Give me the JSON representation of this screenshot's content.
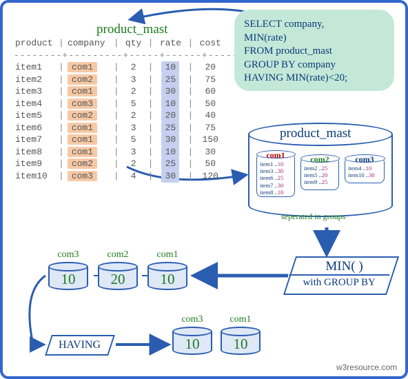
{
  "table_title": "product_mast",
  "headers": {
    "product": "product",
    "company": "company",
    "qty": "qty",
    "rate": "rate",
    "cost": "cost"
  },
  "rows": [
    {
      "product": "item1",
      "company": "com1",
      "qty": "2",
      "rate": "10",
      "cost": "20"
    },
    {
      "product": "item2",
      "company": "com2",
      "qty": "3",
      "rate": "25",
      "cost": "75"
    },
    {
      "product": "item3",
      "company": "com1",
      "qty": "2",
      "rate": "30",
      "cost": "60"
    },
    {
      "product": "item4",
      "company": "com3",
      "qty": "5",
      "rate": "10",
      "cost": "50"
    },
    {
      "product": "item5",
      "company": "com2",
      "qty": "2",
      "rate": "20",
      "cost": "40"
    },
    {
      "product": "item6",
      "company": "com1",
      "qty": "3",
      "rate": "25",
      "cost": "75"
    },
    {
      "product": "item7",
      "company": "com1",
      "qty": "5",
      "rate": "30",
      "cost": "150"
    },
    {
      "product": "item8",
      "company": "com1",
      "qty": "3",
      "rate": "10",
      "cost": "30"
    },
    {
      "product": "item9",
      "company": "com2",
      "qty": "2",
      "rate": "25",
      "cost": "50"
    },
    {
      "product": "item10",
      "company": "com3",
      "qty": "4",
      "rate": "30",
      "cost": "120"
    }
  ],
  "sql": {
    "l1": "SELECT company,",
    "l2": "MIN(rate)",
    "l3": "FROM product_mast",
    "l4": "GROUP BY company",
    "l5": "HAVING MIN(rate)<20;"
  },
  "groups_cyl_title": "product_mast",
  "groups_caption": "seperated in groups",
  "groups": {
    "com1": {
      "name": "com1",
      "items": [
        {
          "i": "item1",
          "r": "10"
        },
        {
          "i": "item3",
          "r": "30"
        },
        {
          "i": "item6",
          "r": "25"
        },
        {
          "i": "item7",
          "r": "30"
        },
        {
          "i": "item8",
          "r": "10"
        }
      ]
    },
    "com2": {
      "name": "com2",
      "items": [
        {
          "i": "item2",
          "r": "25"
        },
        {
          "i": "item5",
          "r": "20"
        },
        {
          "i": "item9",
          "r": "25"
        }
      ]
    },
    "com3": {
      "name": "com3",
      "items": [
        {
          "i": "item4",
          "r": "10"
        },
        {
          "i": "item10",
          "r": "30"
        }
      ]
    }
  },
  "min_results": {
    "com1": {
      "name": "com1",
      "val": "10"
    },
    "com2": {
      "name": "com2",
      "val": "20"
    },
    "com3": {
      "name": "com3",
      "val": "10"
    }
  },
  "min_box": {
    "title": "MIN( )",
    "sub": "with GROUP BY"
  },
  "having_label": "HAVING",
  "having_results": {
    "com3": {
      "name": "com3",
      "val": "10"
    },
    "com1": {
      "name": "com1",
      "val": "10"
    }
  },
  "credit": "w3resource.com",
  "chart_data": {
    "type": "table",
    "title": "product_mast",
    "columns": [
      "product",
      "company",
      "qty",
      "rate",
      "cost"
    ],
    "rows": [
      [
        "item1",
        "com1",
        2,
        10,
        20
      ],
      [
        "item2",
        "com2",
        3,
        25,
        75
      ],
      [
        "item3",
        "com1",
        2,
        30,
        60
      ],
      [
        "item4",
        "com3",
        5,
        10,
        50
      ],
      [
        "item5",
        "com2",
        2,
        20,
        40
      ],
      [
        "item6",
        "com1",
        3,
        25,
        75
      ],
      [
        "item7",
        "com1",
        5,
        30,
        150
      ],
      [
        "item8",
        "com1",
        3,
        10,
        30
      ],
      [
        "item9",
        "com2",
        2,
        25,
        50
      ],
      [
        "item10",
        "com3",
        4,
        30,
        120
      ]
    ],
    "query": "SELECT company, MIN(rate) FROM product_mast GROUP BY company HAVING MIN(rate)<20;",
    "group_by_min": [
      {
        "company": "com1",
        "min_rate": 10
      },
      {
        "company": "com2",
        "min_rate": 20
      },
      {
        "company": "com3",
        "min_rate": 10
      }
    ],
    "having_result": [
      {
        "company": "com3",
        "min_rate": 10
      },
      {
        "company": "com1",
        "min_rate": 10
      }
    ]
  }
}
